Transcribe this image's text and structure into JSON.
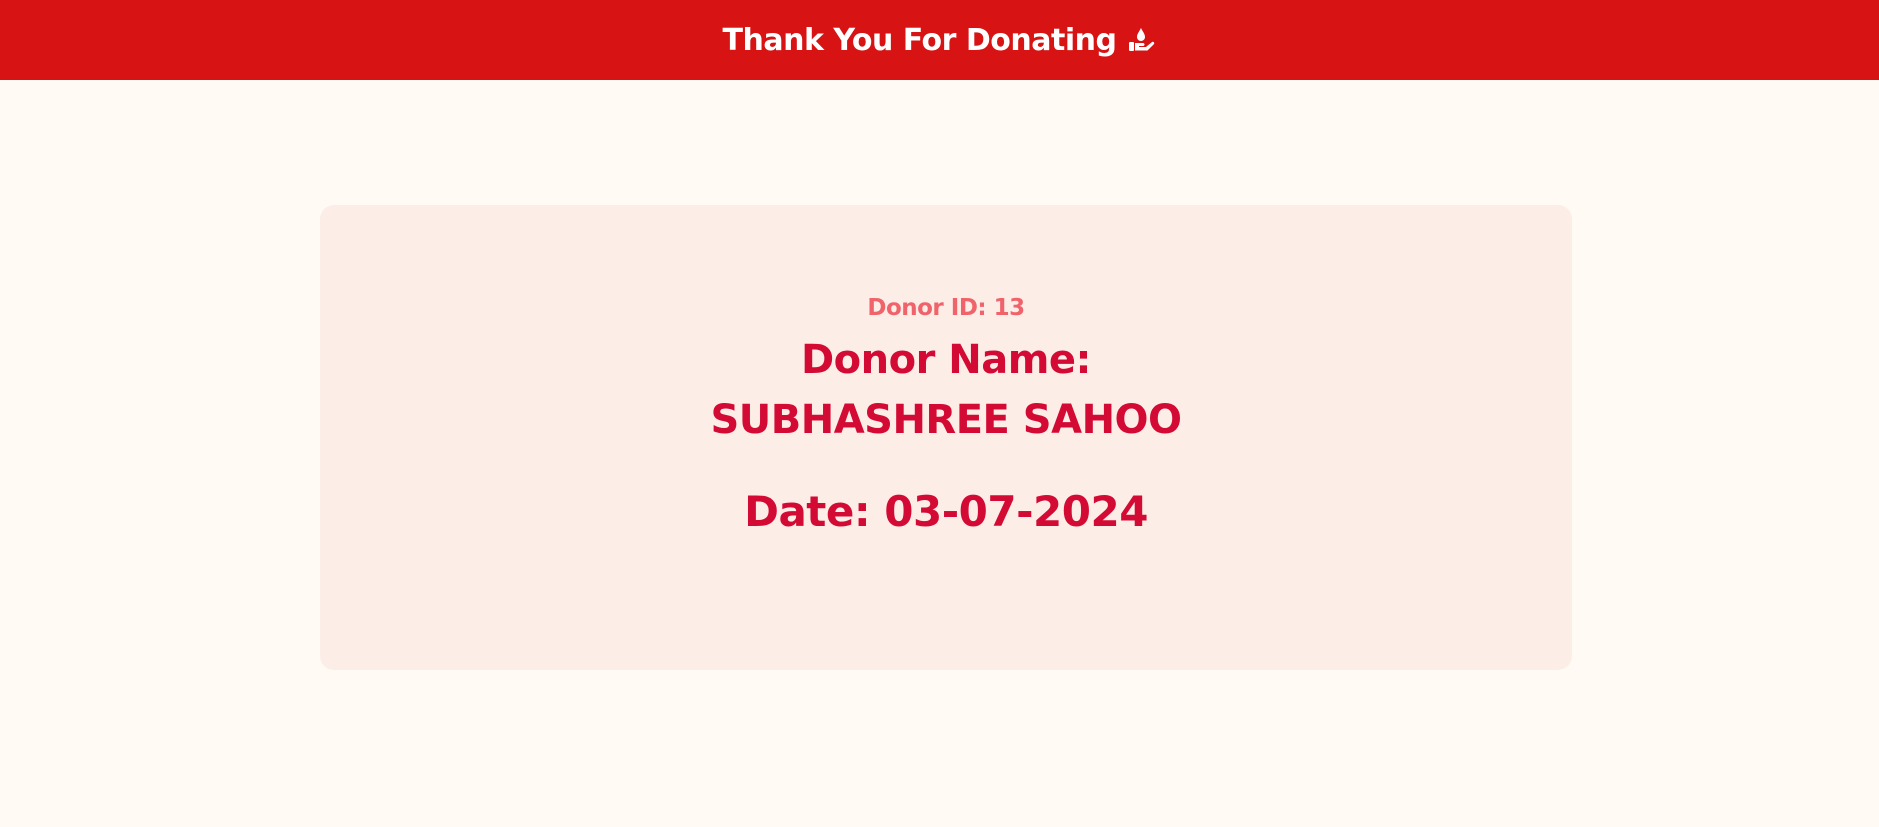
{
  "header": {
    "title": "Thank You For Donating",
    "icon": "donation-hand-icon"
  },
  "card": {
    "donor_id": "Donor ID: 13",
    "donor_name": "Donor Name: SUBHASHREE SAHOO",
    "date": "Date: 03-07-2024"
  },
  "colors": {
    "header_bg": "#d71313",
    "page_bg": "#fffaf4",
    "card_bg": "#fdede7",
    "accent_text": "#d30a34",
    "id_text": "#f0636b"
  }
}
